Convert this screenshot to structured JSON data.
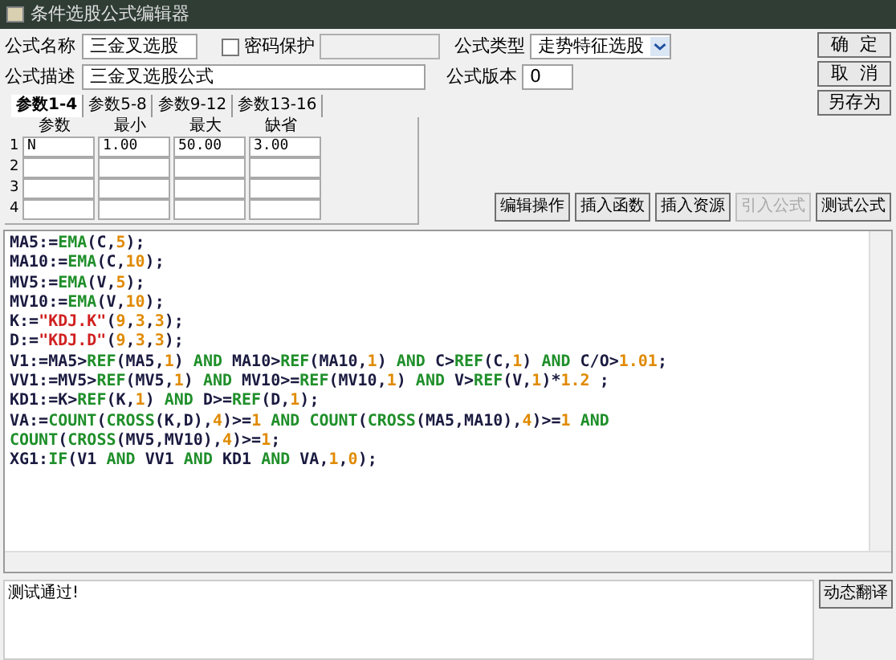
{
  "window": {
    "title": "条件选股公式编辑器"
  },
  "form": {
    "name_label": "公式名称",
    "name_value": "三金叉选股",
    "password": {
      "label": "密码保护",
      "checked": false
    },
    "type_label": "公式类型",
    "type_value": "走势特征选股",
    "desc_label": "公式描述",
    "desc_value": "三金叉选股公式",
    "version_label": "公式版本",
    "version_value": "0"
  },
  "side_buttons": [
    "确  定",
    "取  消",
    "另存为"
  ],
  "tabs": [
    {
      "label": "参数1-4",
      "selected": true
    },
    {
      "label": "参数5-8",
      "selected": false
    },
    {
      "label": "参数9-12",
      "selected": false
    },
    {
      "label": "参数13-16",
      "selected": false
    }
  ],
  "params": {
    "columns": [
      "参数",
      "最小",
      "最大",
      "缺省"
    ],
    "rows": [
      {
        "index": "1",
        "cells": [
          "N",
          "1.00",
          "50.00",
          "3.00"
        ]
      },
      {
        "index": "2"
      },
      {
        "index": "3"
      },
      {
        "index": "4"
      }
    ]
  },
  "tool_buttons": [
    {
      "label": "编辑操作",
      "disabled": false
    },
    {
      "label": "插入函数",
      "disabled": false
    },
    {
      "label": "插入资源",
      "disabled": false
    },
    {
      "label": "引入公式",
      "disabled": true
    },
    {
      "label": "测试公式",
      "disabled": false
    }
  ],
  "code": [
    [
      {
        "t": "MA5:=",
        "kind": "var"
      },
      {
        "t": "EMA",
        "kind": "func"
      },
      {
        "t": "(C,",
        "kind": "var"
      },
      {
        "t": "5",
        "kind": "num"
      },
      {
        "t": ");",
        "kind": "var"
      }
    ],
    [
      {
        "t": "MA10:=",
        "kind": "var"
      },
      {
        "t": "EMA",
        "kind": "func"
      },
      {
        "t": "(C,",
        "kind": "var"
      },
      {
        "t": "10",
        "kind": "num"
      },
      {
        "t": ");",
        "kind": "var"
      }
    ],
    [
      {
        "t": "MV5:=",
        "kind": "var"
      },
      {
        "t": "EMA",
        "kind": "func"
      },
      {
        "t": "(V,",
        "kind": "var"
      },
      {
        "t": "5",
        "kind": "num"
      },
      {
        "t": ");",
        "kind": "var"
      }
    ],
    [
      {
        "t": "MV10:=",
        "kind": "var"
      },
      {
        "t": "EMA",
        "kind": "func"
      },
      {
        "t": "(V,",
        "kind": "var"
      },
      {
        "t": "10",
        "kind": "num"
      },
      {
        "t": ");",
        "kind": "var"
      }
    ],
    [
      {
        "t": "K:=",
        "kind": "var"
      },
      {
        "t": "\"KDJ.K\"",
        "kind": "str"
      },
      {
        "t": "(",
        "kind": "var"
      },
      {
        "t": "9",
        "kind": "num"
      },
      {
        "t": ",",
        "kind": "var"
      },
      {
        "t": "3",
        "kind": "num"
      },
      {
        "t": ",",
        "kind": "var"
      },
      {
        "t": "3",
        "kind": "num"
      },
      {
        "t": ");",
        "kind": "var"
      }
    ],
    [
      {
        "t": "D:=",
        "kind": "var"
      },
      {
        "t": "\"KDJ.D\"",
        "kind": "str"
      },
      {
        "t": "(",
        "kind": "var"
      },
      {
        "t": "9",
        "kind": "num"
      },
      {
        "t": ",",
        "kind": "var"
      },
      {
        "t": "3",
        "kind": "num"
      },
      {
        "t": ",",
        "kind": "var"
      },
      {
        "t": "3",
        "kind": "num"
      },
      {
        "t": ");",
        "kind": "var"
      }
    ],
    [
      {
        "t": "V1:=MA5>",
        "kind": "var"
      },
      {
        "t": "REF",
        "kind": "func"
      },
      {
        "t": "(MA5,",
        "kind": "var"
      },
      {
        "t": "1",
        "kind": "num"
      },
      {
        "t": ") ",
        "kind": "var"
      },
      {
        "t": "AND",
        "kind": "func"
      },
      {
        "t": " MA10>",
        "kind": "var"
      },
      {
        "t": "REF",
        "kind": "func"
      },
      {
        "t": "(MA10,",
        "kind": "var"
      },
      {
        "t": "1",
        "kind": "num"
      },
      {
        "t": ") ",
        "kind": "var"
      },
      {
        "t": "AND",
        "kind": "func"
      },
      {
        "t": " C>",
        "kind": "var"
      },
      {
        "t": "REF",
        "kind": "func"
      },
      {
        "t": "(C,",
        "kind": "var"
      },
      {
        "t": "1",
        "kind": "num"
      },
      {
        "t": ") ",
        "kind": "var"
      },
      {
        "t": "AND",
        "kind": "func"
      },
      {
        "t": " C/O>",
        "kind": "var"
      },
      {
        "t": "1.01",
        "kind": "num"
      },
      {
        "t": ";",
        "kind": "var"
      }
    ],
    [
      {
        "t": "VV1:=MV5>",
        "kind": "var"
      },
      {
        "t": "REF",
        "kind": "func"
      },
      {
        "t": "(MV5,",
        "kind": "var"
      },
      {
        "t": "1",
        "kind": "num"
      },
      {
        "t": ") ",
        "kind": "var"
      },
      {
        "t": "AND",
        "kind": "func"
      },
      {
        "t": " MV10>=",
        "kind": "var"
      },
      {
        "t": "REF",
        "kind": "func"
      },
      {
        "t": "(MV10,",
        "kind": "var"
      },
      {
        "t": "1",
        "kind": "num"
      },
      {
        "t": ") ",
        "kind": "var"
      },
      {
        "t": "AND",
        "kind": "func"
      },
      {
        "t": " V>",
        "kind": "var"
      },
      {
        "t": "REF",
        "kind": "func"
      },
      {
        "t": "(V,",
        "kind": "var"
      },
      {
        "t": "1",
        "kind": "num"
      },
      {
        "t": ")*",
        "kind": "var"
      },
      {
        "t": "1.2",
        "kind": "num"
      },
      {
        "t": " ;",
        "kind": "var"
      }
    ],
    [
      {
        "t": "KD1:=K>",
        "kind": "var"
      },
      {
        "t": "REF",
        "kind": "func"
      },
      {
        "t": "(K,",
        "kind": "var"
      },
      {
        "t": "1",
        "kind": "num"
      },
      {
        "t": ") ",
        "kind": "var"
      },
      {
        "t": "AND",
        "kind": "func"
      },
      {
        "t": " D>=",
        "kind": "var"
      },
      {
        "t": "REF",
        "kind": "func"
      },
      {
        "t": "(D,",
        "kind": "var"
      },
      {
        "t": "1",
        "kind": "num"
      },
      {
        "t": ");",
        "kind": "var"
      }
    ],
    [
      {
        "t": "VA:=",
        "kind": "var"
      },
      {
        "t": "COUNT",
        "kind": "func"
      },
      {
        "t": "(",
        "kind": "var"
      },
      {
        "t": "CROSS",
        "kind": "func"
      },
      {
        "t": "(K,D),",
        "kind": "var"
      },
      {
        "t": "4",
        "kind": "num"
      },
      {
        "t": ")>=",
        "kind": "var"
      },
      {
        "t": "1",
        "kind": "num"
      },
      {
        "t": " AND ",
        "kind": "func"
      },
      {
        "t": "COUNT",
        "kind": "func"
      },
      {
        "t": "(",
        "kind": "var"
      },
      {
        "t": "CROSS",
        "kind": "func"
      },
      {
        "t": "(MA5,MA10),",
        "kind": "var"
      },
      {
        "t": "4",
        "kind": "num"
      },
      {
        "t": ")>=",
        "kind": "var"
      },
      {
        "t": "1",
        "kind": "num"
      },
      {
        "t": " AND",
        "kind": "func"
      }
    ],
    [
      {
        "t": "COUNT",
        "kind": "func"
      },
      {
        "t": "(",
        "kind": "var"
      },
      {
        "t": "CROSS",
        "kind": "func"
      },
      {
        "t": "(MV5,MV10),",
        "kind": "var"
      },
      {
        "t": "4",
        "kind": "num"
      },
      {
        "t": ")>=",
        "kind": "var"
      },
      {
        "t": "1",
        "kind": "num"
      },
      {
        "t": ";",
        "kind": "var"
      }
    ],
    [
      {
        "t": "XG1:",
        "kind": "var"
      },
      {
        "t": "IF",
        "kind": "func"
      },
      {
        "t": "(V1 ",
        "kind": "var"
      },
      {
        "t": "AND",
        "kind": "func"
      },
      {
        "t": " VV1 ",
        "kind": "var"
      },
      {
        "t": "AND",
        "kind": "func"
      },
      {
        "t": " KD1 ",
        "kind": "var"
      },
      {
        "t": "AND",
        "kind": "func"
      },
      {
        "t": " VA,",
        "kind": "var"
      },
      {
        "t": "1",
        "kind": "num"
      },
      {
        "t": ",",
        "kind": "var"
      },
      {
        "t": "0",
        "kind": "num"
      },
      {
        "t": ");",
        "kind": "var"
      }
    ]
  ],
  "status": {
    "message": "测试通过!",
    "button": "动态翻译"
  }
}
